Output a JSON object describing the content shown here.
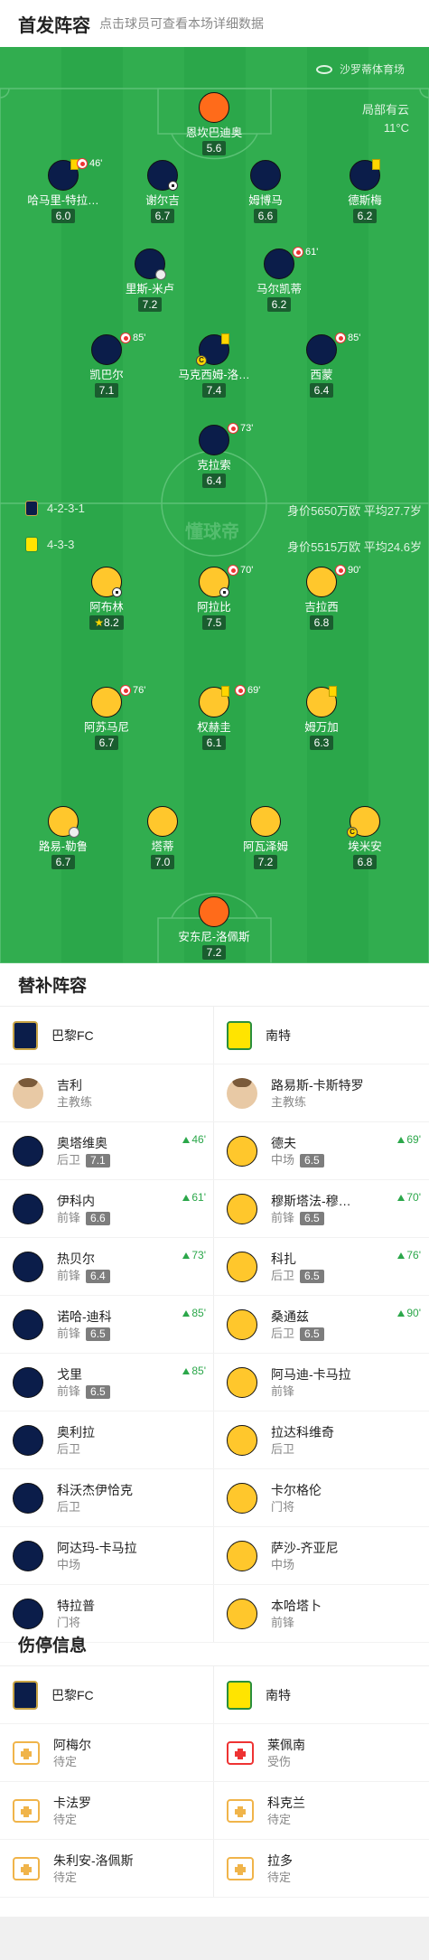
{
  "header": {
    "title": "首发阵容",
    "subtitle": "点击球员可查看本场详细数据"
  },
  "venue": "沙罗蒂体育场",
  "weather": {
    "condition": "局部有云",
    "temp": "11°C"
  },
  "watermark": "懂球帝",
  "home": {
    "formation": "4-2-3-1",
    "info": "身价5650万欧 平均27.7岁"
  },
  "away": {
    "formation": "4-3-3",
    "info": "身价5515万欧 平均24.6岁"
  },
  "lineup": [
    {
      "name": "恩坎巴迪奥",
      "rating": "5.6"
    },
    {
      "name": "哈马里-特拉…",
      "rating": "6.0",
      "sub": "46'"
    },
    {
      "name": "谢尔吉",
      "rating": "6.7"
    },
    {
      "name": "姆博马",
      "rating": "6.6"
    },
    {
      "name": "德斯梅",
      "rating": "6.2"
    },
    {
      "name": "里斯-米卢",
      "rating": "7.2"
    },
    {
      "name": "马尔凯蒂",
      "rating": "6.2",
      "sub": "61'"
    },
    {
      "name": "凯巴尔",
      "rating": "7.1",
      "sub": "85'"
    },
    {
      "name": "马克西姆-洛…",
      "rating": "7.4"
    },
    {
      "name": "西蒙",
      "rating": "6.4",
      "sub": "85'"
    },
    {
      "name": "克拉索",
      "rating": "6.4",
      "sub": "73'"
    },
    {
      "name": "阿布林",
      "rating": "8.2"
    },
    {
      "name": "阿拉比",
      "rating": "7.5",
      "sub": "70'"
    },
    {
      "name": "吉拉西",
      "rating": "6.8",
      "sub": "90'"
    },
    {
      "name": "阿苏马尼",
      "rating": "6.7",
      "sub": "76'"
    },
    {
      "name": "权赫圭",
      "rating": "6.1",
      "sub": "69'"
    },
    {
      "name": "姆万加",
      "rating": "6.3"
    },
    {
      "name": "路易-勒鲁",
      "rating": "6.7"
    },
    {
      "name": "塔蒂",
      "rating": "7.0"
    },
    {
      "name": "阿瓦泽姆",
      "rating": "7.2"
    },
    {
      "name": "埃米安",
      "rating": "6.8"
    },
    {
      "name": "安东尼-洛佩斯",
      "rating": "7.2"
    }
  ],
  "subs_title": "替补阵容",
  "teams": {
    "home": "巴黎FC",
    "away": "南特"
  },
  "coaches": {
    "home": {
      "name": "吉利",
      "role": "主教练"
    },
    "away": {
      "name": "路易斯-卡斯特罗",
      "role": "主教练"
    }
  },
  "subs": [
    [
      {
        "name": "奥塔维奥",
        "pos": "后卫",
        "rating": "7.1",
        "min": "46'"
      },
      {
        "name": "德夫",
        "pos": "中场",
        "rating": "6.5",
        "min": "69'"
      }
    ],
    [
      {
        "name": "伊科内",
        "pos": "前锋",
        "rating": "6.6",
        "min": "61'"
      },
      {
        "name": "穆斯塔法-穆…",
        "pos": "前锋",
        "rating": "6.5",
        "min": "70'"
      }
    ],
    [
      {
        "name": "热贝尔",
        "pos": "前锋",
        "rating": "6.4",
        "min": "73'"
      },
      {
        "name": "科扎",
        "pos": "后卫",
        "rating": "6.5",
        "min": "76'"
      }
    ],
    [
      {
        "name": "诺哈-迪科",
        "pos": "前锋",
        "rating": "6.5",
        "min": "85'"
      },
      {
        "name": "桑通兹",
        "pos": "后卫",
        "rating": "6.5",
        "min": "90'"
      }
    ],
    [
      {
        "name": "戈里",
        "pos": "前锋",
        "rating": "6.5",
        "min": "85'"
      },
      {
        "name": "阿马迪-卡马拉",
        "pos": "前锋"
      }
    ],
    [
      {
        "name": "奥利拉",
        "pos": "后卫"
      },
      {
        "name": "拉达科维奇",
        "pos": "后卫"
      }
    ],
    [
      {
        "name": "科沃杰伊恰克",
        "pos": "后卫"
      },
      {
        "name": "卡尔格伦",
        "pos": "门将"
      }
    ],
    [
      {
        "name": "阿达玛-卡马拉",
        "pos": "中场"
      },
      {
        "name": "萨沙-齐亚尼",
        "pos": "中场"
      }
    ],
    [
      {
        "name": "特拉普",
        "pos": "门将"
      },
      {
        "name": "本哈塔卜",
        "pos": "前锋"
      }
    ]
  ],
  "injury_title": "伤停信息",
  "injuries": [
    [
      {
        "name": "阿梅尔",
        "status": "待定"
      },
      {
        "name": "莱佩南",
        "status": "受伤"
      }
    ],
    [
      {
        "name": "卡法罗",
        "status": "待定"
      },
      {
        "name": "科克兰",
        "status": "待定"
      }
    ],
    [
      {
        "name": "朱利安-洛佩斯",
        "status": "待定"
      },
      {
        "name": "拉多",
        "status": "待定"
      }
    ]
  ]
}
